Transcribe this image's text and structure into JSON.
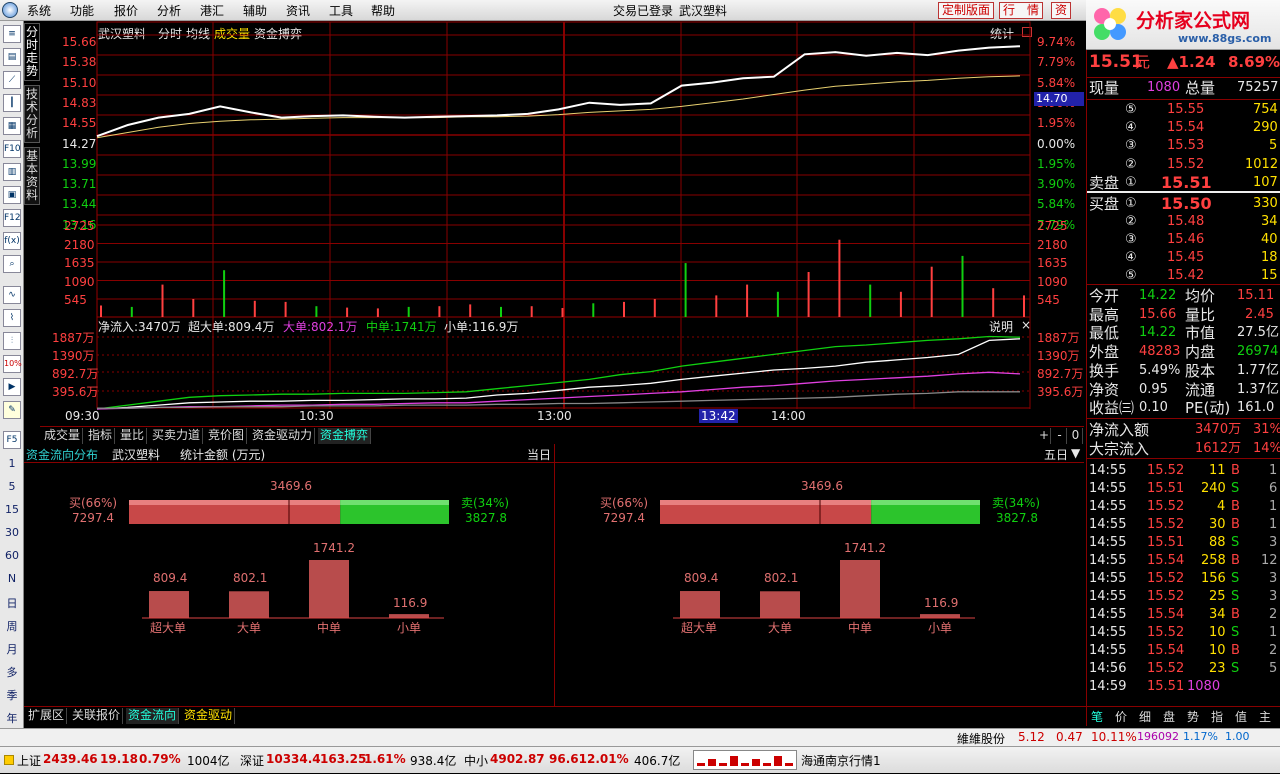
{
  "menubar": {
    "items": [
      "系统",
      "功能",
      "报价",
      "分析",
      "港汇",
      "辅助",
      "资讯",
      "工具",
      "帮助"
    ],
    "status": "交易已登录",
    "stock": "武汉塑料",
    "buttons": [
      "定制版面",
      "行　情",
      "资"
    ]
  },
  "logo": {
    "text": "分析家公式网",
    "url": "www.88gs.com"
  },
  "toolbar": {
    "period_labels": [
      "1",
      "5",
      "15",
      "30",
      "60",
      "N",
      "日",
      "周",
      "月",
      "多",
      "季",
      "年"
    ],
    "f5": "F5",
    "pct": "10%"
  },
  "vtabs": [
    "分时走势",
    "技术分析",
    "基本资料"
  ],
  "chart": {
    "title": "武汉塑料",
    "modes": [
      "分时",
      "均线",
      "成交量",
      "资金搏弈"
    ],
    "stat_btn": "统计",
    "price_tag": "14.70",
    "price_ticks": [
      "15.66",
      "15.38",
      "15.10",
      "14.83",
      "14.55",
      "14.27",
      "13.99",
      "13.71",
      "13.44",
      "13.16"
    ],
    "pct_ticks": [
      "9.74%",
      "7.79%",
      "5.84%",
      "3.90%",
      "1.95%",
      "0.00%",
      "1.95%",
      "3.90%",
      "5.84%",
      "7.79%"
    ],
    "vol_ticks": [
      "2725",
      "2180",
      "1635",
      "1090",
      "545"
    ],
    "flow_ticks": [
      "1887万",
      "1390万",
      "892.7万",
      "395.6万"
    ],
    "time_ticks": [
      "09:30",
      "10:30",
      "13:00",
      "14:00"
    ],
    "cursor_time": "13:42",
    "flow_legend": {
      "net": "净流入:3470万",
      "super": "超大单:809.4万",
      "big": "大单:802.1万",
      "mid": "中单:1741万",
      "small": "小单:116.9万"
    },
    "explain_btn": "说明"
  },
  "chart_data": [
    {
      "type": "line",
      "title": "武汉塑料",
      "series": [
        {
          "name": "分时",
          "values": [
            14.3,
            14.45,
            14.55,
            14.6,
            14.7,
            14.62,
            14.55,
            14.57,
            14.58,
            14.56,
            14.55,
            14.56,
            14.57,
            14.58,
            14.6,
            14.66,
            14.75,
            14.72,
            14.74,
            14.98,
            15.02,
            15.08,
            15.1,
            15.4,
            15.43,
            15.38,
            15.42,
            15.39,
            15.45,
            15.49,
            15.51
          ]
        },
        {
          "name": "均线",
          "values": [
            14.28,
            14.35,
            14.42,
            14.47,
            14.5,
            14.52,
            14.53,
            14.54,
            14.55,
            14.55,
            14.55,
            14.55,
            14.56,
            14.56,
            14.57,
            14.59,
            14.62,
            14.64,
            14.66,
            14.7,
            14.75,
            14.8,
            14.86,
            14.92,
            14.97,
            15.0,
            15.03,
            15.05,
            15.08,
            15.1,
            15.11
          ]
        }
      ],
      "ylim": [
        13.16,
        15.66
      ]
    },
    {
      "type": "bar",
      "title": "成交量",
      "values": [
        320,
        280,
        900,
        500,
        1300,
        450,
        420,
        300,
        260,
        240,
        280,
        300,
        350,
        280,
        300,
        250,
        380,
        420,
        500,
        1500,
        600,
        900,
        700,
        1250,
        2150,
        900,
        700,
        1400,
        1700,
        800,
        600
      ],
      "ylim": [
        0,
        2725
      ]
    },
    {
      "type": "bar",
      "title": "资金流向分布",
      "categories": [
        "超大单",
        "大单",
        "中单",
        "小单"
      ],
      "values": [
        809.4,
        802.1,
        1741.2,
        116.9
      ],
      "buy": {
        "label": "买(66%)",
        "value": "7297.4"
      },
      "sell": {
        "label": "卖(34%)",
        "value": "3827.8"
      },
      "net": "3469.6"
    }
  ],
  "bottom_tabs": [
    "成交量",
    "指标",
    "量比",
    "买卖力道",
    "竞价图",
    "资金驱动力",
    "资金搏弈"
  ],
  "bottom_ctrl": [
    "+",
    "-",
    "0"
  ],
  "flow_panel": {
    "title": "资金流向分布",
    "stock": "武汉塑料",
    "unit": "统计金额 (万元)",
    "today": "当日",
    "five_day": "五日",
    "cats": [
      "超大单",
      "大单",
      "中单",
      "小单"
    ],
    "vals": [
      "809.4",
      "802.1",
      "1741.2",
      "116.9"
    ],
    "net": "3469.6",
    "buy_label": "买(66%)",
    "buy_val": "7297.4",
    "sell_label": "卖(34%)",
    "sell_val": "3827.8"
  },
  "ext_tabs": [
    "扩展区",
    "关联报价",
    "资金流向",
    "资金驱动"
  ],
  "right": {
    "price": "15.51",
    "unit": "元",
    "change": "▲1.24",
    "pct": "8.69%",
    "xianliang_l": "现量",
    "xianliang": "1080",
    "zongliang_l": "总量",
    "zongliang": "75257",
    "asks": [
      {
        "n": "⑤",
        "p": "15.55",
        "v": "754"
      },
      {
        "n": "④",
        "p": "15.54",
        "v": "290"
      },
      {
        "n": "③",
        "p": "15.53",
        "v": "5"
      },
      {
        "n": "②",
        "p": "15.52",
        "v": "1012"
      },
      {
        "n": "①",
        "p": "15.51",
        "v": "107"
      }
    ],
    "bids": [
      {
        "n": "①",
        "p": "15.50",
        "v": "330"
      },
      {
        "n": "②",
        "p": "15.48",
        "v": "34"
      },
      {
        "n": "③",
        "p": "15.46",
        "v": "40"
      },
      {
        "n": "④",
        "p": "15.45",
        "v": "18"
      },
      {
        "n": "⑤",
        "p": "15.42",
        "v": "15"
      }
    ],
    "sell_label": "卖盘",
    "buy_label": "买盘",
    "stats": [
      [
        "今开",
        "14.22",
        "均价",
        "15.11"
      ],
      [
        "最高",
        "15.66",
        "量比",
        "2.45"
      ],
      [
        "最低",
        "14.22",
        "市值",
        "27.5亿"
      ],
      [
        "外盘",
        "48283",
        "内盘",
        "26974"
      ],
      [
        "换手",
        "5.49%",
        "股本",
        "1.77亿"
      ],
      [
        "净资",
        "0.95",
        "流通",
        "1.37亿"
      ],
      [
        "收益㈢",
        "0.10",
        "PE(动)",
        "161.0"
      ]
    ],
    "flows": [
      [
        "净流入额",
        "3470万",
        "31%"
      ],
      [
        "大宗流入",
        "1612万",
        "14%"
      ]
    ],
    "ticks": [
      [
        "14:55",
        "15.52",
        "11",
        "B",
        "1"
      ],
      [
        "14:55",
        "15.51",
        "240",
        "S",
        "6"
      ],
      [
        "14:55",
        "15.52",
        "4",
        "B",
        "1"
      ],
      [
        "14:55",
        "15.52",
        "30",
        "B",
        "1"
      ],
      [
        "14:55",
        "15.51",
        "88",
        "S",
        "3"
      ],
      [
        "14:55",
        "15.54",
        "258",
        "B",
        "12"
      ],
      [
        "14:55",
        "15.52",
        "156",
        "S",
        "3"
      ],
      [
        "14:55",
        "15.52",
        "25",
        "S",
        "3"
      ],
      [
        "14:55",
        "15.54",
        "34",
        "B",
        "2"
      ],
      [
        "14:55",
        "15.52",
        "10",
        "S",
        "1"
      ],
      [
        "14:55",
        "15.54",
        "10",
        "B",
        "2"
      ],
      [
        "14:56",
        "15.52",
        "23",
        "S",
        "5"
      ],
      [
        "14:59",
        "15.51",
        "1080",
        "",
        ""
      ]
    ],
    "tabs": [
      "笔",
      "价",
      "细",
      "盘",
      "势",
      "指",
      "值",
      "主"
    ]
  },
  "ticker": {
    "name": "維維股份",
    "price": "5.12",
    "change": "0.47",
    "pct": "10.11%",
    "vol": "196092",
    "turn": "1.17%",
    "ratio": "1.00"
  },
  "status": {
    "sh_label": "上证",
    "sh": "2439.46",
    "sh_chg": "19.18",
    "sh_pct": "0.79%",
    "sh_amt": "1004亿",
    "sz_label": "深证",
    "sz": "10334.4",
    "sz_chg": "163.25",
    "sz_pct": "1.61%",
    "sz_amt": "938.4亿",
    "zx_label": "中小",
    "zx": "4902.87",
    "zx_chg": "96.61",
    "zx_pct": "2.01%",
    "zx_amt": "406.7亿",
    "broker": "海通南京行情1"
  }
}
